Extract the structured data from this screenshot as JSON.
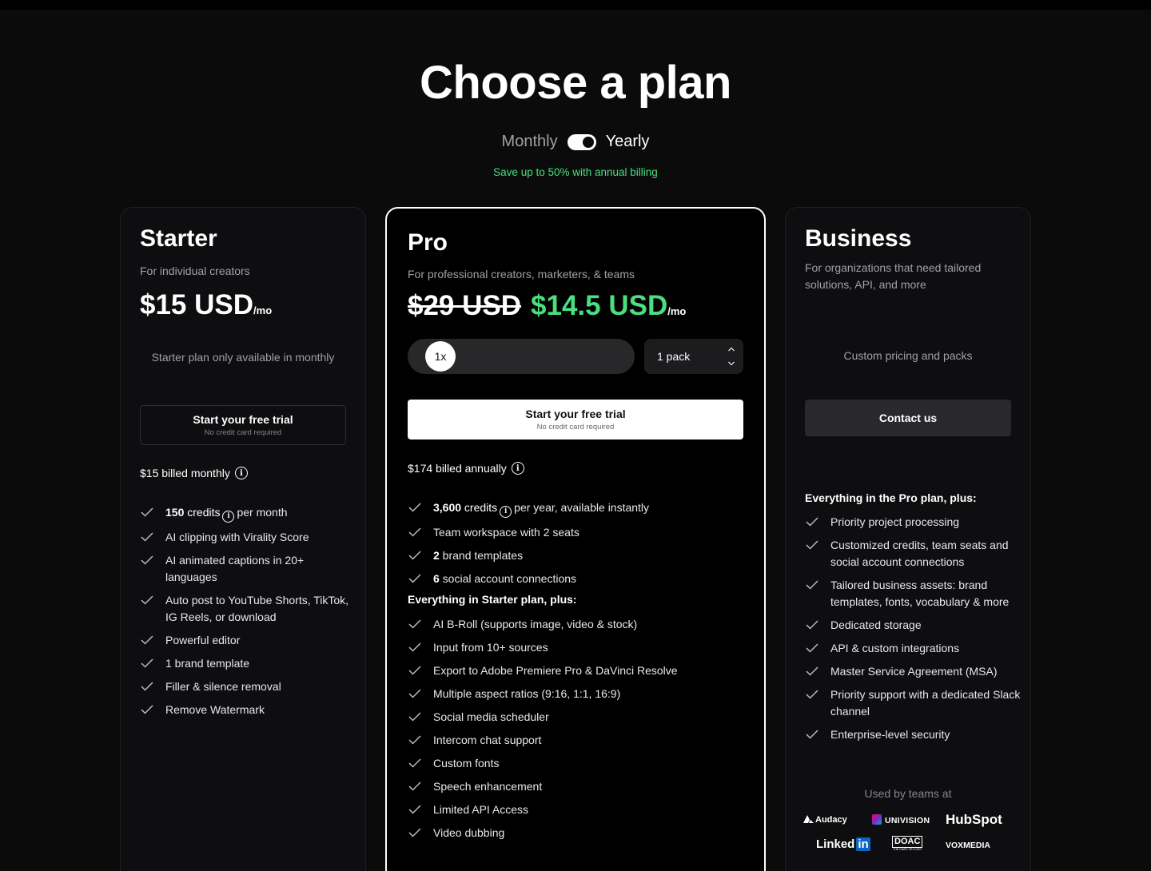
{
  "header": {
    "title": "Choose a plan",
    "monthly_label": "Monthly",
    "yearly_label": "Yearly",
    "save_text": "Save up to 50% with annual billing"
  },
  "colors": {
    "accent_green": "#4ade80",
    "background": "#0b0b0c"
  },
  "starter": {
    "name": "Starter",
    "subtitle": "For individual creators",
    "price": "$15 USD",
    "per": "/mo",
    "note": "Starter plan only available in monthly",
    "cta_main": "Start your free trial",
    "cta_sub": "No credit card required",
    "billed": "$15 billed monthly",
    "features": {
      "f1_bold": "150",
      "f1_a": " credits",
      "f1_b": "per month",
      "f2": "AI clipping with Virality Score",
      "f3": "AI animated captions in 20+ languages",
      "f4": "Auto post to YouTube Shorts, TikTok, IG Reels, or download",
      "f5": "Powerful editor",
      "f6": "1 brand template",
      "f7": "Filler & silence removal",
      "f8": "Remove Watermark"
    }
  },
  "pro": {
    "name": "Pro",
    "subtitle": "For professional creators, marketers, & teams",
    "old_price": "$29 USD",
    "price": "$14.5 USD",
    "per": "/mo",
    "multiplier": "1x",
    "pack_select": "1 pack",
    "cta_main": "Start your free trial",
    "cta_sub": "No credit card required",
    "billed": "$174 billed annually",
    "features": {
      "f1_bold": "3,600",
      "f1_a": " credits",
      "f1_b": "per year, available instantly",
      "f2": "Team workspace with 2 seats",
      "f3_bold": "2",
      "f3": " brand templates",
      "f4_bold": "6",
      "f4": " social account connections"
    },
    "extra_heading": "Everything in Starter plan, plus:",
    "extras": [
      "AI B-Roll (supports image, video & stock)",
      "Input from 10+ sources",
      "Export to Adobe Premiere Pro & DaVinci Resolve",
      "Multiple aspect ratios (9:16, 1:1, 16:9)",
      "Social media scheduler",
      "Intercom chat support",
      "Custom fonts",
      "Speech enhancement",
      "Limited API Access",
      "Video dubbing"
    ]
  },
  "business": {
    "name": "Business",
    "subtitle": "For organizations that need tailored solutions, API, and more",
    "note": "Custom pricing and packs",
    "cta_main": "Contact us",
    "extra_heading": "Everything in the Pro plan, plus:",
    "extras": [
      "Priority project processing",
      "Customized credits, team seats and social account connections",
      "Tailored business assets: brand templates, fonts, vocabulary & more",
      "Dedicated storage",
      "API & custom integrations",
      "Master Service Agreement (MSA)",
      "Priority support with a dedicated Slack channel",
      "Enterprise-level security"
    ],
    "used_by": "Used by teams at",
    "logos": {
      "audacy": "Audacy",
      "univision": "UNIVISION",
      "hubspot": "HubSpot",
      "linkedin_a": "Linked",
      "linkedin_b": "in",
      "doac": "DOAC",
      "doac_sub": "THE DIARY OF A CEO",
      "vox": "VOXMEDIA"
    }
  }
}
